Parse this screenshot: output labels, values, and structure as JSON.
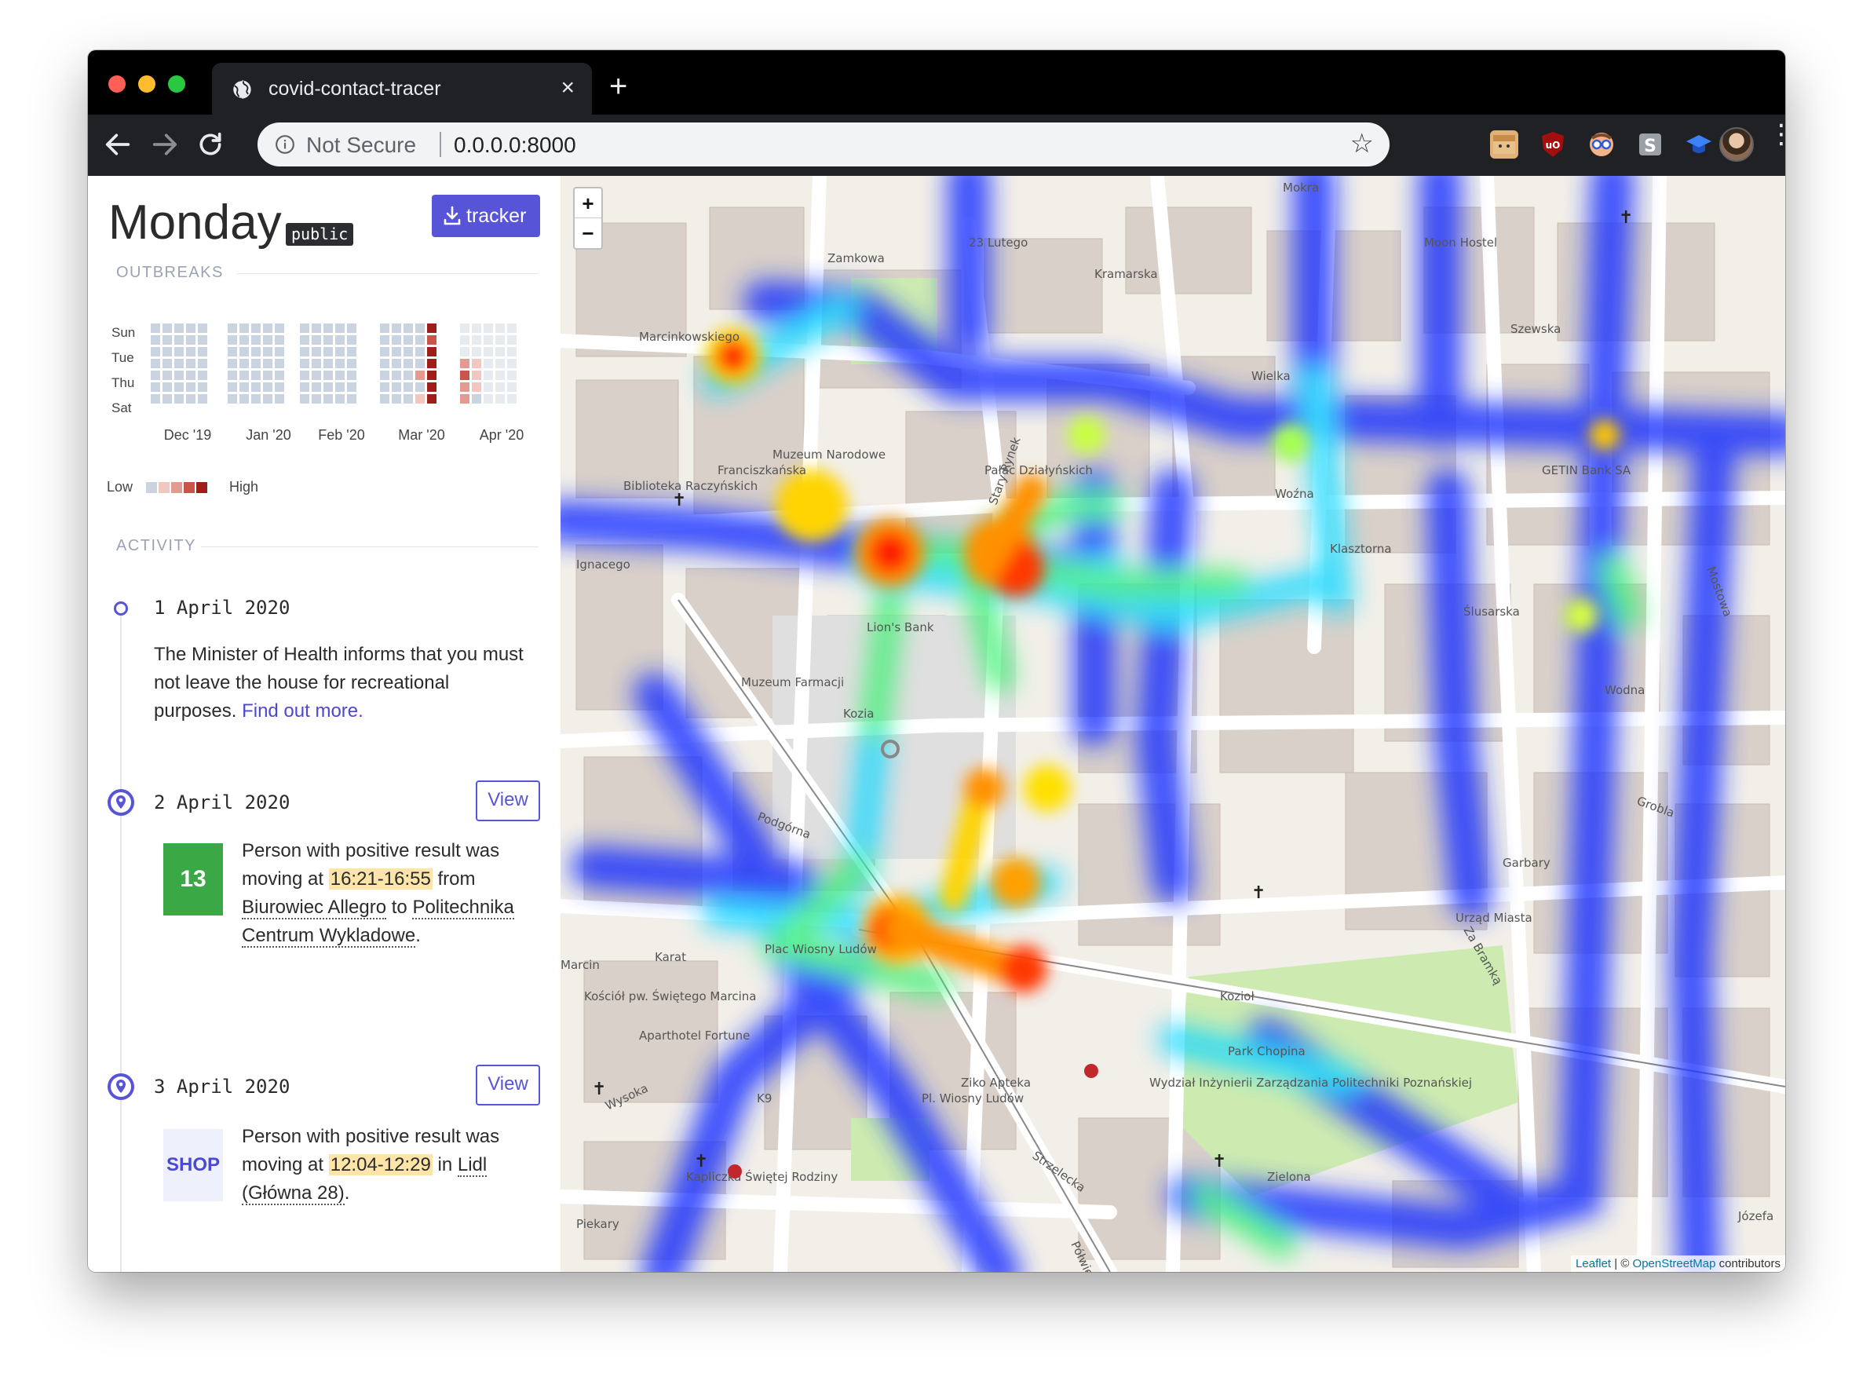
{
  "browser": {
    "tab_title": "covid-contact-tracer",
    "close_glyph": "×",
    "new_tab_glyph": "+",
    "not_secure": "Not Secure",
    "url": "0.0.0.0:8000",
    "star_glyph": "☆",
    "menu_glyph": "⋮",
    "extensions": [
      "extension-box-icon",
      "ublock-icon",
      "extension-glasses-icon",
      "extension-s-icon",
      "extension-cap-icon"
    ]
  },
  "header": {
    "title": "Monday",
    "badge": "public",
    "tracker_button": "tracker"
  },
  "outbreaks": {
    "label": "OUTBREAKS",
    "days": [
      "Sun",
      "Tue",
      "Thu",
      "Sat"
    ],
    "months": [
      "Dec '19",
      "Jan '20",
      "Feb '20",
      "Mar '20",
      "Apr '20"
    ],
    "legend_low": "Low",
    "legend_high": "High",
    "colors": [
      "#c9d4e0",
      "#f2c7c1",
      "#e39a90",
      "#c9554a",
      "#9e1f1a"
    ]
  },
  "activity": {
    "label": "ACTIVITY",
    "entries": [
      {
        "date": "1 April 2020",
        "text": "The Minister of Health informs that you must not leave the house for recreational purposes.",
        "link": "Find out more."
      },
      {
        "date": "2 April 2020",
        "view": "View",
        "badge": "13",
        "text_a": "Person with positive result was moving at",
        "time": "16:21-16:55",
        "text_b": "from",
        "from": "Biurowiec Allegro",
        "text_c": "to",
        "to": "Politechnika Centrum Wykladowe",
        "end": "."
      },
      {
        "date": "3 April 2020",
        "view": "View",
        "badge": "SHOP",
        "text_a": "Person with positive result was moving at",
        "time": "12:04-12:29",
        "text_b": "in",
        "place": "Lidl (Główna 28)",
        "end": "."
      }
    ]
  },
  "map": {
    "zoom_in": "+",
    "zoom_out": "−",
    "attribution_link1": "Leaflet",
    "attribution_sep": " | © ",
    "attribution_link2": "OpenStreetMap",
    "attribution_tail": " contributors",
    "labels": [
      "Mokra",
      "23 Lutego",
      "Kramarska",
      "Zamkowa",
      "Marcinkowskiego",
      "Muzeum Narodowe",
      "Franciszkańska",
      "Pałac Działyńskich",
      "Stary Rynek",
      "Wielka",
      "Woźna",
      "Ignacego",
      "Lion's Bank",
      "Kozia",
      "Muzeum Farmacji",
      "Podgórna",
      "Plac Wiosny Ludów",
      "Ziko Apteka",
      "Strzelecka",
      "Park Chopina",
      "Garbary",
      "Za Bramką",
      "Grobla",
      "Mostowa",
      "Zielona",
      "Piekary",
      "Półwiejska",
      "Wysoka",
      "Kościół pw. Świętego Marcina",
      "Aparthotel Fortune",
      "Urząd Miasta",
      "Kozioł",
      "Moon Hostel",
      "GETIN Bank SA",
      "Biblioteka Raczyńskich",
      "Szewska",
      "Klasztorna",
      "Ślusarska",
      "Wodna",
      "Kapliczka Świętej Rodziny",
      "Wydział Inżynierii Zarządzania Politechniki Poznańskiej",
      "Pl. Wiosny Ludów",
      "K9",
      "Karat",
      "Marcin",
      "Józefa"
    ]
  }
}
